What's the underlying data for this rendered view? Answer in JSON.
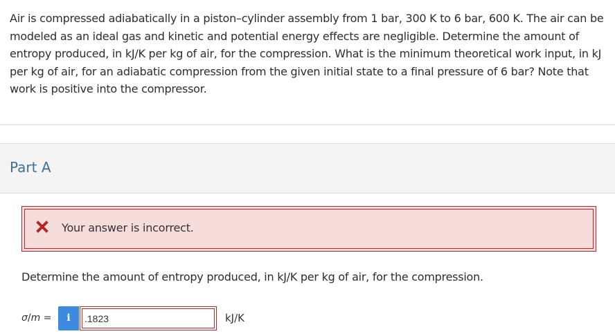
{
  "problem": {
    "text": "Air is compressed adiabatically in a piston–cylinder assembly from 1 bar, 300 K to 6 bar, 600 K. The air can be modeled as an ideal gas and kinetic and potential energy effects are negligible. Determine the amount of entropy produced, in kJ/K per kg of air, for the compression. What is the minimum theoretical work input, in kJ per kg of air, for an adiabatic compression from the given initial state to a final pressure of 6 bar? Note that work is positive into the compressor."
  },
  "part": {
    "title": "Part A"
  },
  "feedback": {
    "icon": "x-mark-icon",
    "message": "Your answer is incorrect.",
    "color": "#b3262b",
    "background": "#f7dcdc"
  },
  "question": {
    "text": "Determine the amount of entropy produced, in kJ/K per kg of air, for the compression."
  },
  "answer": {
    "variable_symbol": "σ",
    "variable_denominator": "m",
    "equals": "=",
    "info_label": "i",
    "value": ".1823",
    "unit": "kJ/K"
  },
  "colors": {
    "part_title": "#3f6f99",
    "info_button": "#3d8be0"
  }
}
